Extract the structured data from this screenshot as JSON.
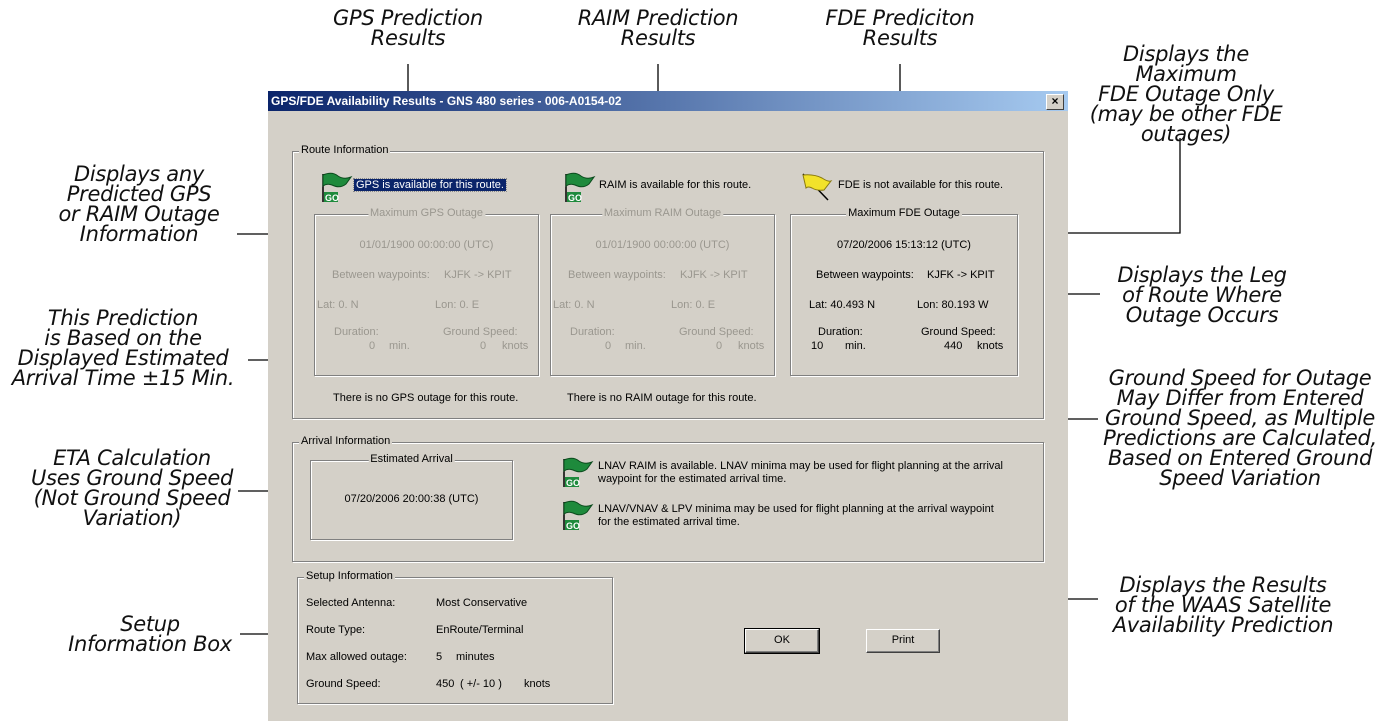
{
  "annotations": {
    "gps_prediction": [
      "GPS Prediction",
      "Results"
    ],
    "raim_prediction": [
      "RAIM Prediction",
      "Results"
    ],
    "fde_prediction": [
      "FDE Prediciton",
      "Results"
    ],
    "max_fde": [
      "Displays the Maximum",
      "FDE Outage Only",
      "(may be other FDE",
      "outages)"
    ],
    "predicted_outage": [
      "Displays any",
      "Predicted GPS",
      "or RAIM Outage",
      "Information"
    ],
    "prediction_basis": [
      "This Prediction",
      "is Based on the",
      "Displayed Estimated",
      "Arrival Time ±15 Min."
    ],
    "leg": [
      "Displays the Leg",
      "of Route Where",
      "Outage Occurs"
    ],
    "ground_speed_note": [
      "Ground Speed for Outage",
      "May Differ from Entered",
      "Ground Speed, as Multiple",
      "Predictions are Calculated,",
      "Based on Entered Ground",
      "Speed Variation"
    ],
    "eta": [
      "ETA Calculation",
      "Uses Ground Speed",
      "(Not Ground Speed",
      "Variation)"
    ],
    "waas": [
      "Displays the Results",
      "of the WAAS Satellite",
      "Availability Prediction"
    ],
    "setup": [
      "Setup",
      "Information Box"
    ]
  },
  "dialog": {
    "title": "GPS/FDE Availability Results - GNS 480 series - 006-A0154-02",
    "close": "×",
    "route": {
      "legend": "Route Information",
      "gps": {
        "status": "GPS is available for this route.",
        "box_title": "Maximum GPS Outage",
        "time": "01/01/1900 00:00:00 (UTC)",
        "between_label": "Between waypoints:",
        "between_value": "KJFK -> KPIT",
        "lat": "Lat:  0. N",
        "lon": "Lon:  0. E",
        "duration_label": "Duration:",
        "gs_label": "Ground Speed:",
        "duration_value": "0",
        "duration_unit": "min.",
        "gs_value": "0",
        "gs_unit": "knots",
        "footer": "There is no GPS outage for this route."
      },
      "raim": {
        "status": "RAIM is available for this route.",
        "box_title": "Maximum RAIM Outage",
        "time": "01/01/1900 00:00:00 (UTC)",
        "between_label": "Between waypoints:",
        "between_value": "KJFK -> KPIT",
        "lat": "Lat:  0. N",
        "lon": "Lon:  0. E",
        "duration_label": "Duration:",
        "gs_label": "Ground Speed:",
        "duration_value": "0",
        "duration_unit": "min.",
        "gs_value": "0",
        "gs_unit": "knots",
        "footer": "There is no RAIM outage for this route."
      },
      "fde": {
        "status": "FDE is not available for this route.",
        "box_title": "Maximum FDE Outage",
        "time": "07/20/2006 15:13:12 (UTC)",
        "between_label": "Between waypoints:",
        "between_value": "KJFK -> KPIT",
        "lat": "Lat:  40.493 N",
        "lon": "Lon:  80.193 W",
        "duration_label": "Duration:",
        "gs_label": "Ground Speed:",
        "duration_value": "10",
        "duration_unit": "min.",
        "gs_value": "440",
        "gs_unit": "knots"
      }
    },
    "arrival": {
      "legend": "Arrival Information",
      "box_title": "Estimated Arrival",
      "time": "07/20/2006 20:00:38 (UTC)",
      "lnav_line1": "LNAV RAIM is available. LNAV minima may be used for flight planning at the arrival",
      "lnav_line2": "waypoint for the estimated arrival time.",
      "lpv_line1": "LNAV/VNAV & LPV minima may be used for flight planning at the arrival waypoint",
      "lpv_line2": "for the estimated arrival time."
    },
    "setup": {
      "legend": "Setup Information",
      "antenna_label": "Selected Antenna:",
      "antenna_value": "Most Conservative",
      "route_type_label": "Route Type:",
      "route_type_value": "EnRoute/Terminal",
      "max_outage_label": "Max allowed outage:",
      "max_outage_value": "5",
      "max_outage_unit": "minutes",
      "gs_label": "Ground Speed:",
      "gs_value": "450",
      "gs_variation": "( +/- 10 )",
      "gs_unit": "knots"
    },
    "buttons": {
      "ok": "OK",
      "print": "Print"
    },
    "flag_text": "GO"
  },
  "colors": {
    "go_flag": "#1e8a3c",
    "warn_flag": "#f2e22a",
    "title_start": "#0a246a",
    "title_end": "#a6caf0"
  }
}
